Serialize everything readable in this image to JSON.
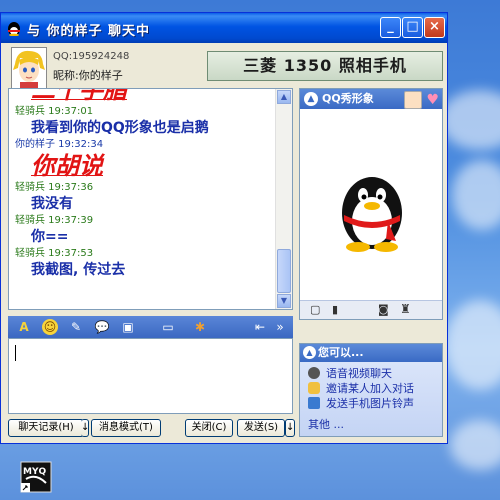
{
  "window": {
    "title": "与 你的样子 聊天中",
    "buttons": {
      "minimize": "_",
      "maximize": "□",
      "close": "×"
    }
  },
  "contact": {
    "qq_number": "QQ:195924248",
    "nickname": "昵称:你的样子"
  },
  "ad_banner": "三菱 1350 照相手机",
  "messages": [
    {
      "kind": "text-red",
      "text": "二个手脂"
    },
    {
      "kind": "meta-green",
      "text": "轻骑兵 19:37:01"
    },
    {
      "kind": "text-blue",
      "text": "我看到你的QQ形象也是启鹅"
    },
    {
      "kind": "meta-blue",
      "text": "你的样子 19:32:34"
    },
    {
      "kind": "text-red",
      "text": "你胡说"
    },
    {
      "kind": "meta-green",
      "text": "轻骑兵 19:37:36"
    },
    {
      "kind": "text-blue",
      "text": "我没有"
    },
    {
      "kind": "meta-green",
      "text": "轻骑兵 19:37:39"
    },
    {
      "kind": "text-blue",
      "text": "你=="
    },
    {
      "kind": "meta-green",
      "text": "轻骑兵 19:37:53"
    },
    {
      "kind": "text-blue",
      "text": "我截图, 传过去"
    }
  ],
  "buttons": {
    "history": "聊天记录(H)",
    "message_mode": "消息模式(T)",
    "close": "关闭(C)",
    "send": "发送(S)"
  },
  "qq_show": {
    "title": "QQ秀形象"
  },
  "options": {
    "title": "您可以...",
    "items": [
      {
        "icon": "camera-icon",
        "label": "语音视频聊天"
      },
      {
        "icon": "invite-icon",
        "label": "邀请某人加入对话"
      },
      {
        "icon": "phone-icon",
        "label": "发送手机图片铃声"
      }
    ],
    "more": "其他 ..."
  },
  "desktop_icon_label": "MYQ"
}
